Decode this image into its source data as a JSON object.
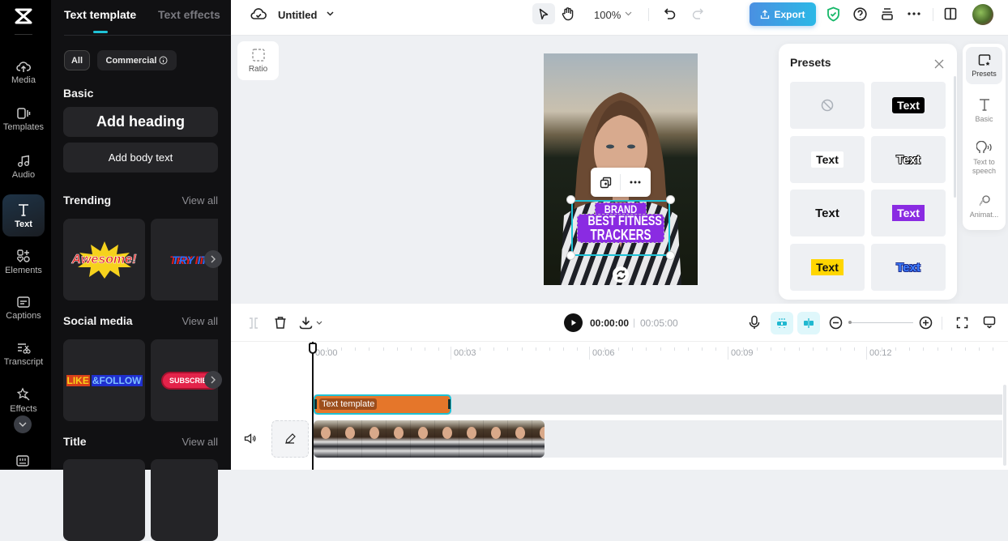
{
  "rail": {
    "items": [
      {
        "label": "Media",
        "icon": "cloud-upload-icon"
      },
      {
        "label": "Templates",
        "icon": "templates-icon"
      },
      {
        "label": "Audio",
        "icon": "music-note-icon"
      },
      {
        "label": "Text",
        "icon": "text-icon",
        "active": true
      },
      {
        "label": "Elements",
        "icon": "elements-icon"
      },
      {
        "label": "Captions",
        "icon": "captions-icon"
      },
      {
        "label": "Transcript",
        "icon": "transcript-icon"
      },
      {
        "label": "Effects",
        "icon": "effects-icon"
      }
    ]
  },
  "panel": {
    "tabs": [
      {
        "label": "Text template",
        "active": true
      },
      {
        "label": "Text effects"
      }
    ],
    "filters": {
      "all": "All",
      "commercial": "Commercial"
    },
    "basic": {
      "title": "Basic",
      "add_heading": "Add heading",
      "add_body": "Add body text"
    },
    "sections": [
      {
        "title": "Trending",
        "view_all": "View all",
        "cards": [
          "Awesome!",
          "TRY IT!"
        ]
      },
      {
        "title": "Social media",
        "view_all": "View all",
        "cards": [
          "LIKE",
          "&FOLLOW",
          "SUBSCRIBE"
        ]
      },
      {
        "title": "Title",
        "view_all": "View all"
      }
    ]
  },
  "topbar": {
    "project_name": "Untitled",
    "zoom": "100%",
    "export_label": "Export"
  },
  "canvas": {
    "ratio_label": "Ratio",
    "overlay_text": {
      "line1": "BRAND",
      "line2": "BEST FITNESS",
      "line3": "TRACKERS"
    }
  },
  "presets": {
    "title": "Presets",
    "tiles": [
      "none",
      "Text",
      "Text",
      "Text",
      "Text",
      "Text",
      "Text",
      "Text"
    ]
  },
  "side_tools": [
    {
      "label": "Presets",
      "active": true
    },
    {
      "label": "Basic"
    },
    {
      "label": "Text to speech"
    },
    {
      "label": "Animat..."
    }
  ],
  "timeline": {
    "current_time": "00:00:00",
    "total_time": "00:05:00",
    "ruler": [
      "00:00",
      "00:03",
      "00:06",
      "00:09",
      "00:12"
    ],
    "text_clip_label": "Text template"
  },
  "colors": {
    "accent": "#1fc2d6",
    "text_clip": "#e5762a",
    "overlay_purple": "#8a2be2",
    "export_start": "#4a90e2",
    "export_end": "#2bb8e6"
  }
}
